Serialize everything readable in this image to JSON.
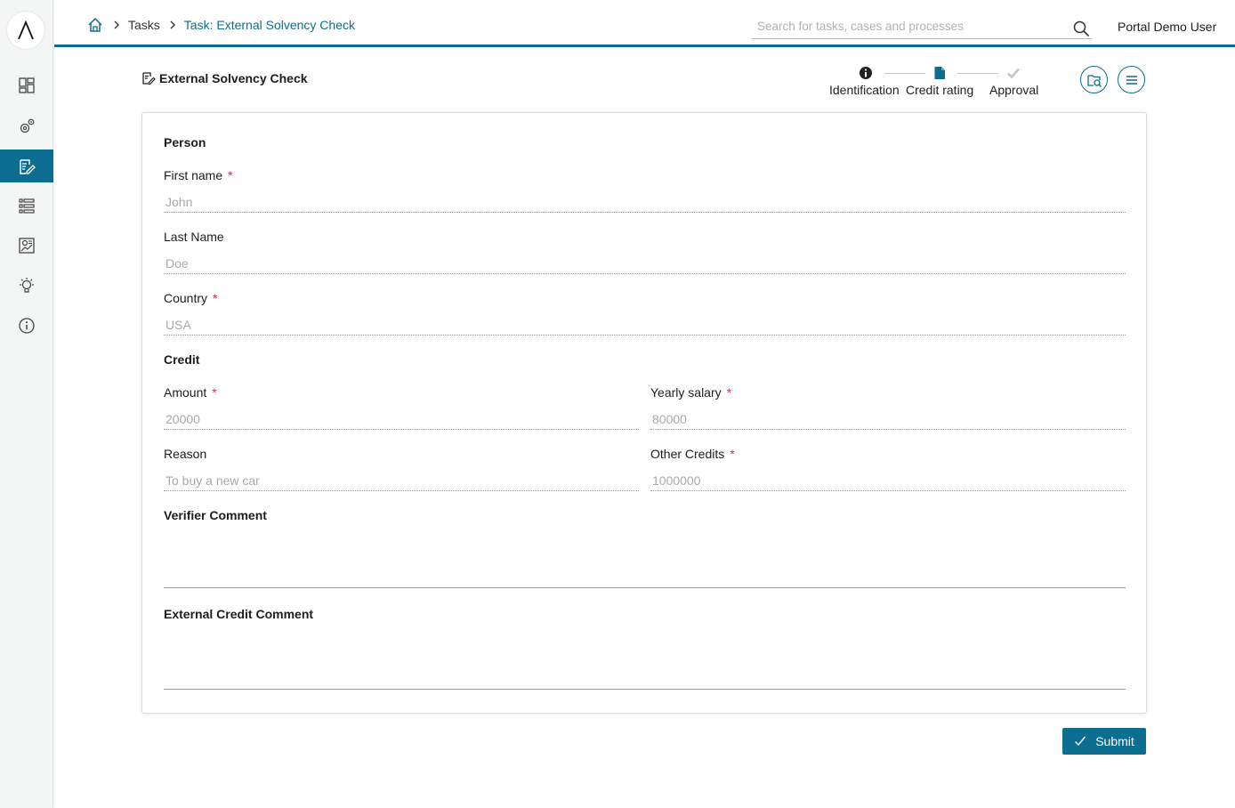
{
  "theme": {
    "accent": "#0b6d8f",
    "required": "#d62b4b"
  },
  "sidebar": {
    "logo_icon": "axon-ivy-logo",
    "items": [
      {
        "icon": "dashboard-icon",
        "active": false
      },
      {
        "icon": "processes-icon",
        "active": false
      },
      {
        "icon": "tasks-icon",
        "active": true
      },
      {
        "icon": "cases-icon",
        "active": false
      },
      {
        "icon": "statistics-icon",
        "active": false
      },
      {
        "icon": "idea-icon",
        "active": false
      },
      {
        "icon": "info-icon",
        "active": false
      }
    ]
  },
  "header": {
    "breadcrumb": [
      "Tasks",
      "Task: External Solvency Check"
    ],
    "search_placeholder": "Search for tasks, cases and processes",
    "user": "Portal Demo User"
  },
  "page": {
    "title": "External Solvency Check",
    "steps": [
      {
        "label": "Identification",
        "state": "done",
        "icon": "info-circle-icon"
      },
      {
        "label": "Credit rating",
        "state": "current",
        "icon": "document-icon"
      },
      {
        "label": "Approval",
        "state": "upcoming",
        "icon": "check-icon"
      }
    ],
    "actions": [
      {
        "icon": "case-details-icon"
      },
      {
        "icon": "menu-icon"
      }
    ]
  },
  "form": {
    "person_section": "Person",
    "first_name": {
      "label": "First name",
      "value": "John",
      "required": "*"
    },
    "last_name": {
      "label": "Last Name",
      "value": "Doe"
    },
    "country": {
      "label": "Country",
      "value": "USA",
      "required": "*"
    },
    "credit_section": "Credit",
    "amount": {
      "label": "Amount",
      "value": "20000",
      "required": "*"
    },
    "yearly_salary": {
      "label": "Yearly salary",
      "value": "80000",
      "required": "*"
    },
    "reason": {
      "label": "Reason",
      "value": "To buy a new car"
    },
    "other_credits": {
      "label": "Other Credits",
      "value": "1000000",
      "required": "*"
    },
    "verifier_comment": {
      "label": "Verifier Comment",
      "value": ""
    },
    "external_credit_comment": {
      "label": "External Credit Comment",
      "value": ""
    }
  },
  "submit_label": "Submit"
}
